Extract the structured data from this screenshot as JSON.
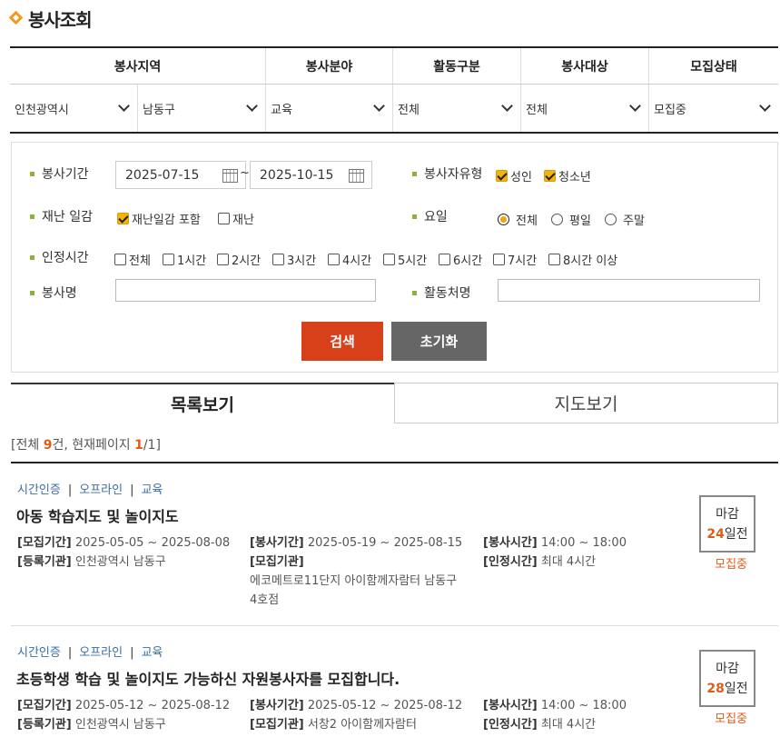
{
  "page": {
    "title": "봉사조회"
  },
  "filters": {
    "headers": [
      "봉사지역",
      "봉사분야",
      "활동구분",
      "봉사대상",
      "모집상태"
    ],
    "selects": [
      "인천광역시",
      "남동구",
      "교육",
      "전체",
      "전체",
      "모집중"
    ]
  },
  "search": {
    "period_label": "봉사기간",
    "date_from": "2025-07-15",
    "date_to": "2025-10-15",
    "tilde": "~",
    "type_label": "봉사자유형",
    "type_adult": "성인",
    "type_youth": "청소년",
    "disaster_label": "재난 일감",
    "disaster_include": "재난일감 포함",
    "disaster_only": "재난",
    "day_label": "요일",
    "day_all": "전체",
    "day_weekday": "평일",
    "day_weekend": "주말",
    "hours_label": "인정시간",
    "hours": [
      "전체",
      "1시간",
      "2시간",
      "3시간",
      "4시간",
      "5시간",
      "6시간",
      "7시간",
      "8시간 이상"
    ],
    "name_label": "봉사명",
    "place_label": "활동처명",
    "search_button": "검색",
    "reset_button": "초기화"
  },
  "tabs": {
    "list": "목록보기",
    "map": "지도보기"
  },
  "count": {
    "prefix": "[전체 ",
    "total": "9",
    "mid": "건, 현재페이지 ",
    "page": "1",
    "suffix": "/1]"
  },
  "items": [
    {
      "tags": [
        "시간인증",
        "오프라인",
        "교육"
      ],
      "title": "아동 학습지도 및 놀이지도",
      "recruit_label": "[모집기간]",
      "recruit": "2025-05-05 ~ 2025-08-08",
      "period_label": "[봉사기간]",
      "period": "2025-05-19 ~ 2025-08-15",
      "time_label": "[봉사시간]",
      "time": "14:00 ~ 18:00",
      "reg_label": "[등록기관]",
      "reg": "인천광역시 남동구",
      "org_label": "[모집기관]",
      "org_line1": "에코메트로11단지 아이함께자람터 남동구",
      "org_line2": "4호점",
      "hours_label": "[인정시간]",
      "hours": "최대 4시간",
      "deadline_top": "마감",
      "deadline_days": "24",
      "deadline_suffix": "일전",
      "status": "모집중"
    },
    {
      "tags": [
        "시간인증",
        "오프라인",
        "교육"
      ],
      "title": "초등학생 학습 및 놀이지도 가능하신 자원봉사자를 모집합니다.",
      "recruit_label": "[모집기간]",
      "recruit": "2025-05-12 ~ 2025-08-12",
      "period_label": "[봉사기간]",
      "period": "2025-05-12 ~ 2025-08-12",
      "time_label": "[봉사시간]",
      "time": "14:00 ~ 18:00",
      "reg_label": "[등록기관]",
      "reg": "인천광역시 남동구",
      "org_label": "[모집기관]",
      "org_line1": "서창2 아이함께자람터",
      "org_line2": "",
      "hours_label": "[인정시간]",
      "hours": "최대 4시간",
      "deadline_top": "마감",
      "deadline_days": "28",
      "deadline_suffix": "일전",
      "status": "모집중"
    }
  ]
}
